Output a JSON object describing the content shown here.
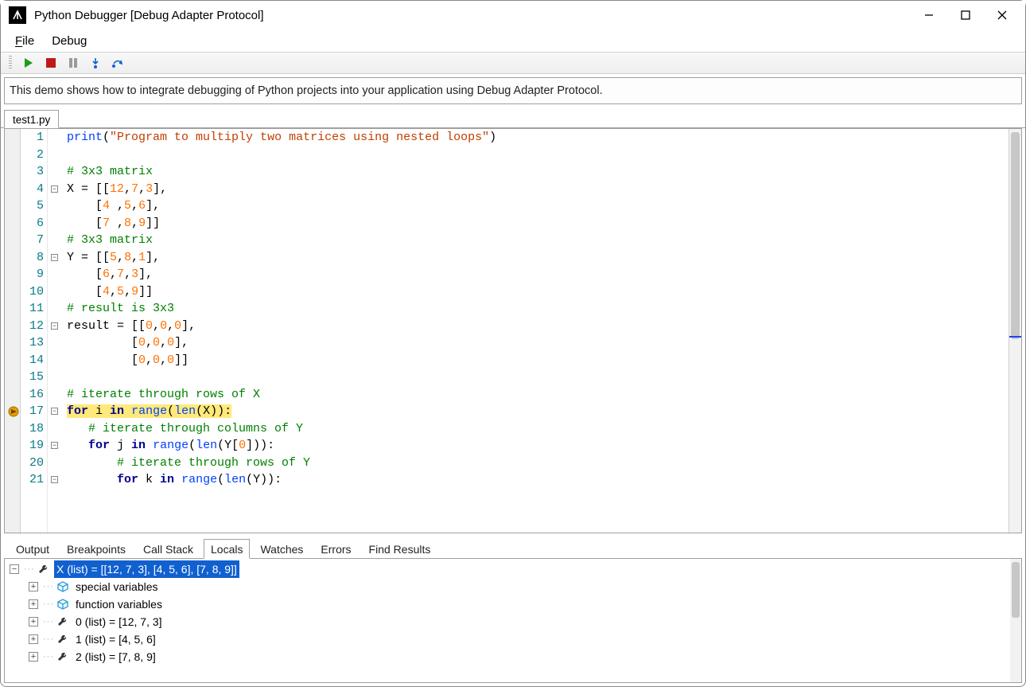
{
  "window": {
    "title": "Python Debugger [Debug Adapter Protocol]"
  },
  "menu": {
    "file": "File",
    "debug": "Debug"
  },
  "toolbar": {
    "run": "Run",
    "stop": "Stop",
    "pause": "Pause",
    "step_into": "Step Into",
    "step_over": "Step Over"
  },
  "info_text": "This demo shows how to integrate debugging of Python projects into your application using Debug Adapter Protocol.",
  "file_tab": "test1.py",
  "current_line": 17,
  "code_lines": [
    {
      "n": 1,
      "tokens": [
        {
          "t": "fn",
          "v": "print"
        },
        {
          "t": "op",
          "v": "("
        },
        {
          "t": "str",
          "v": "\"Program to multiply two matrices using nested loops\""
        },
        {
          "t": "op",
          "v": ")"
        }
      ]
    },
    {
      "n": 2,
      "tokens": []
    },
    {
      "n": 3,
      "tokens": [
        {
          "t": "cmt",
          "v": "# 3x3 matrix"
        }
      ]
    },
    {
      "n": 4,
      "fold": true,
      "tokens": [
        {
          "t": "id",
          "v": "X "
        },
        {
          "t": "op",
          "v": "= [["
        },
        {
          "t": "num",
          "v": "12"
        },
        {
          "t": "op",
          "v": ","
        },
        {
          "t": "num",
          "v": "7"
        },
        {
          "t": "op",
          "v": ","
        },
        {
          "t": "num",
          "v": "3"
        },
        {
          "t": "op",
          "v": "],"
        }
      ]
    },
    {
      "n": 5,
      "tokens": [
        {
          "t": "op",
          "v": "    ["
        },
        {
          "t": "num",
          "v": "4"
        },
        {
          "t": "op",
          "v": " ,"
        },
        {
          "t": "num",
          "v": "5"
        },
        {
          "t": "op",
          "v": ","
        },
        {
          "t": "num",
          "v": "6"
        },
        {
          "t": "op",
          "v": "],"
        }
      ]
    },
    {
      "n": 6,
      "tokens": [
        {
          "t": "op",
          "v": "    ["
        },
        {
          "t": "num",
          "v": "7"
        },
        {
          "t": "op",
          "v": " ,"
        },
        {
          "t": "num",
          "v": "8"
        },
        {
          "t": "op",
          "v": ","
        },
        {
          "t": "num",
          "v": "9"
        },
        {
          "t": "op",
          "v": "]]"
        }
      ]
    },
    {
      "n": 7,
      "tokens": [
        {
          "t": "cmt",
          "v": "# 3x3 matrix"
        }
      ]
    },
    {
      "n": 8,
      "fold": true,
      "tokens": [
        {
          "t": "id",
          "v": "Y "
        },
        {
          "t": "op",
          "v": "= [["
        },
        {
          "t": "num",
          "v": "5"
        },
        {
          "t": "op",
          "v": ","
        },
        {
          "t": "num",
          "v": "8"
        },
        {
          "t": "op",
          "v": ","
        },
        {
          "t": "num",
          "v": "1"
        },
        {
          "t": "op",
          "v": "],"
        }
      ]
    },
    {
      "n": 9,
      "tokens": [
        {
          "t": "op",
          "v": "    ["
        },
        {
          "t": "num",
          "v": "6"
        },
        {
          "t": "op",
          "v": ","
        },
        {
          "t": "num",
          "v": "7"
        },
        {
          "t": "op",
          "v": ","
        },
        {
          "t": "num",
          "v": "3"
        },
        {
          "t": "op",
          "v": "],"
        }
      ]
    },
    {
      "n": 10,
      "tokens": [
        {
          "t": "op",
          "v": "    ["
        },
        {
          "t": "num",
          "v": "4"
        },
        {
          "t": "op",
          "v": ","
        },
        {
          "t": "num",
          "v": "5"
        },
        {
          "t": "op",
          "v": ","
        },
        {
          "t": "num",
          "v": "9"
        },
        {
          "t": "op",
          "v": "]]"
        }
      ]
    },
    {
      "n": 11,
      "tokens": [
        {
          "t": "cmt",
          "v": "# result is 3x3"
        }
      ]
    },
    {
      "n": 12,
      "fold": true,
      "tokens": [
        {
          "t": "id",
          "v": "result "
        },
        {
          "t": "op",
          "v": "= [["
        },
        {
          "t": "num",
          "v": "0"
        },
        {
          "t": "op",
          "v": ","
        },
        {
          "t": "num",
          "v": "0"
        },
        {
          "t": "op",
          "v": ","
        },
        {
          "t": "num",
          "v": "0"
        },
        {
          "t": "op",
          "v": "],"
        }
      ]
    },
    {
      "n": 13,
      "tokens": [
        {
          "t": "op",
          "v": "         ["
        },
        {
          "t": "num",
          "v": "0"
        },
        {
          "t": "op",
          "v": ","
        },
        {
          "t": "num",
          "v": "0"
        },
        {
          "t": "op",
          "v": ","
        },
        {
          "t": "num",
          "v": "0"
        },
        {
          "t": "op",
          "v": "],"
        }
      ]
    },
    {
      "n": 14,
      "tokens": [
        {
          "t": "op",
          "v": "         ["
        },
        {
          "t": "num",
          "v": "0"
        },
        {
          "t": "op",
          "v": ","
        },
        {
          "t": "num",
          "v": "0"
        },
        {
          "t": "op",
          "v": ","
        },
        {
          "t": "num",
          "v": "0"
        },
        {
          "t": "op",
          "v": "]]"
        }
      ]
    },
    {
      "n": 15,
      "tokens": []
    },
    {
      "n": 16,
      "tokens": [
        {
          "t": "cmt",
          "v": "# iterate through rows of X"
        }
      ]
    },
    {
      "n": 17,
      "fold": true,
      "hl": true,
      "tokens": [
        {
          "t": "kw",
          "v": "for"
        },
        {
          "t": "id",
          "v": " i "
        },
        {
          "t": "kw",
          "v": "in"
        },
        {
          "t": "id",
          "v": " "
        },
        {
          "t": "fn",
          "v": "range"
        },
        {
          "t": "op",
          "v": "("
        },
        {
          "t": "fn",
          "v": "len"
        },
        {
          "t": "op",
          "v": "(X)):"
        }
      ]
    },
    {
      "n": 18,
      "tokens": [
        {
          "t": "id",
          "v": "   "
        },
        {
          "t": "cmt",
          "v": "# iterate through columns of Y"
        }
      ]
    },
    {
      "n": 19,
      "fold": true,
      "tokens": [
        {
          "t": "id",
          "v": "   "
        },
        {
          "t": "kw",
          "v": "for"
        },
        {
          "t": "id",
          "v": " j "
        },
        {
          "t": "kw",
          "v": "in"
        },
        {
          "t": "id",
          "v": " "
        },
        {
          "t": "fn",
          "v": "range"
        },
        {
          "t": "op",
          "v": "("
        },
        {
          "t": "fn",
          "v": "len"
        },
        {
          "t": "op",
          "v": "(Y["
        },
        {
          "t": "num",
          "v": "0"
        },
        {
          "t": "op",
          "v": "])):"
        }
      ]
    },
    {
      "n": 20,
      "tokens": [
        {
          "t": "id",
          "v": "       "
        },
        {
          "t": "cmt",
          "v": "# iterate through rows of Y"
        }
      ]
    },
    {
      "n": 21,
      "fold": true,
      "tokens": [
        {
          "t": "id",
          "v": "       "
        },
        {
          "t": "kw",
          "v": "for"
        },
        {
          "t": "id",
          "v": " k "
        },
        {
          "t": "kw",
          "v": "in"
        },
        {
          "t": "id",
          "v": " "
        },
        {
          "t": "fn",
          "v": "range"
        },
        {
          "t": "op",
          "v": "("
        },
        {
          "t": "fn",
          "v": "len"
        },
        {
          "t": "op",
          "v": "(Y)):"
        }
      ]
    }
  ],
  "bottom_tabs": {
    "items": [
      "Output",
      "Breakpoints",
      "Call Stack",
      "Locals",
      "Watches",
      "Errors",
      "Find Results"
    ],
    "active": "Locals"
  },
  "locals": {
    "rows": [
      {
        "depth": 0,
        "kind": "wrench",
        "twisty": "-",
        "selected": true,
        "text": "X (list) = [[12, 7, 3], [4, 5, 6], [7, 8, 9]]"
      },
      {
        "depth": 1,
        "kind": "box",
        "twisty": "+",
        "text": "special variables"
      },
      {
        "depth": 1,
        "kind": "box",
        "twisty": "+",
        "text": "function variables"
      },
      {
        "depth": 1,
        "kind": "wrench",
        "twisty": "+",
        "text": "0 (list) = [12, 7, 3]"
      },
      {
        "depth": 1,
        "kind": "wrench",
        "twisty": "+",
        "text": "1 (list) = [4, 5, 6]"
      },
      {
        "depth": 1,
        "kind": "wrench",
        "twisty": "+",
        "text": "2 (list) = [7, 8, 9]"
      }
    ]
  }
}
